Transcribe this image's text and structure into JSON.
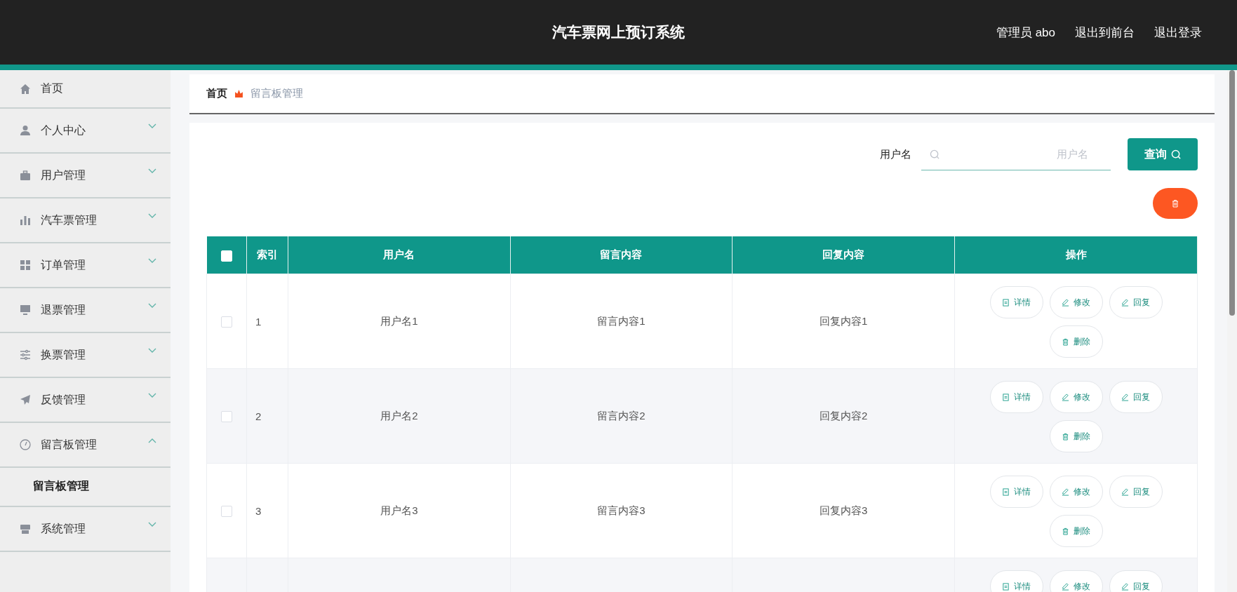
{
  "header": {
    "title": "汽车票网上预订系统",
    "links": [
      "管理员 abo",
      "退出到前台",
      "退出登录"
    ]
  },
  "sidebar": {
    "items": [
      {
        "label": "首页"
      },
      {
        "label": "个人中心",
        "expanded": false
      },
      {
        "label": "用户管理",
        "expanded": false
      },
      {
        "label": "汽车票管理",
        "expanded": false
      },
      {
        "label": "订单管理",
        "expanded": false
      },
      {
        "label": "退票管理",
        "expanded": false
      },
      {
        "label": "换票管理",
        "expanded": false
      },
      {
        "label": "反馈管理",
        "expanded": false
      },
      {
        "label": "留言板管理",
        "expanded": true,
        "children": [
          {
            "label": "留言板管理"
          }
        ]
      },
      {
        "label": "系统管理",
        "expanded": false
      }
    ]
  },
  "breadcrumb": [
    "首页",
    "留言板管理"
  ],
  "search": {
    "label": "用户名",
    "placeholder": "用户名",
    "button": "查询"
  },
  "table": {
    "columns": [
      "索引",
      "用户名",
      "留言内容",
      "回复内容",
      "操作"
    ],
    "all_checked": false,
    "rows": [
      {
        "selected": false,
        "index": "1",
        "username": "用户名1",
        "message": "留言内容1",
        "reply": "回复内容1",
        "actions": [
          {
            "kind": "detail",
            "label": "详情"
          },
          {
            "kind": "edit",
            "label": "修改"
          },
          {
            "kind": "reply",
            "label": "回复"
          },
          {
            "kind": "delete",
            "label": "删除"
          }
        ]
      },
      {
        "selected": false,
        "index": "2",
        "username": "用户名2",
        "message": "留言内容2",
        "reply": "回复内容2",
        "actions": [
          {
            "kind": "detail",
            "label": "详情"
          },
          {
            "kind": "edit",
            "label": "修改"
          },
          {
            "kind": "reply",
            "label": "回复"
          },
          {
            "kind": "delete",
            "label": "删除"
          }
        ]
      },
      {
        "selected": false,
        "index": "3",
        "username": "用户名3",
        "message": "留言内容3",
        "reply": "回复内容3",
        "actions": [
          {
            "kind": "detail",
            "label": "详情"
          },
          {
            "kind": "edit",
            "label": "修改"
          },
          {
            "kind": "reply",
            "label": "回复"
          },
          {
            "kind": "delete",
            "label": "删除"
          }
        ]
      },
      {
        "actions": [
          {
            "kind": "detail",
            "label": "详情"
          },
          {
            "kind": "edit",
            "label": "修改"
          },
          {
            "kind": "reply",
            "label": "回复"
          }
        ]
      }
    ]
  }
}
